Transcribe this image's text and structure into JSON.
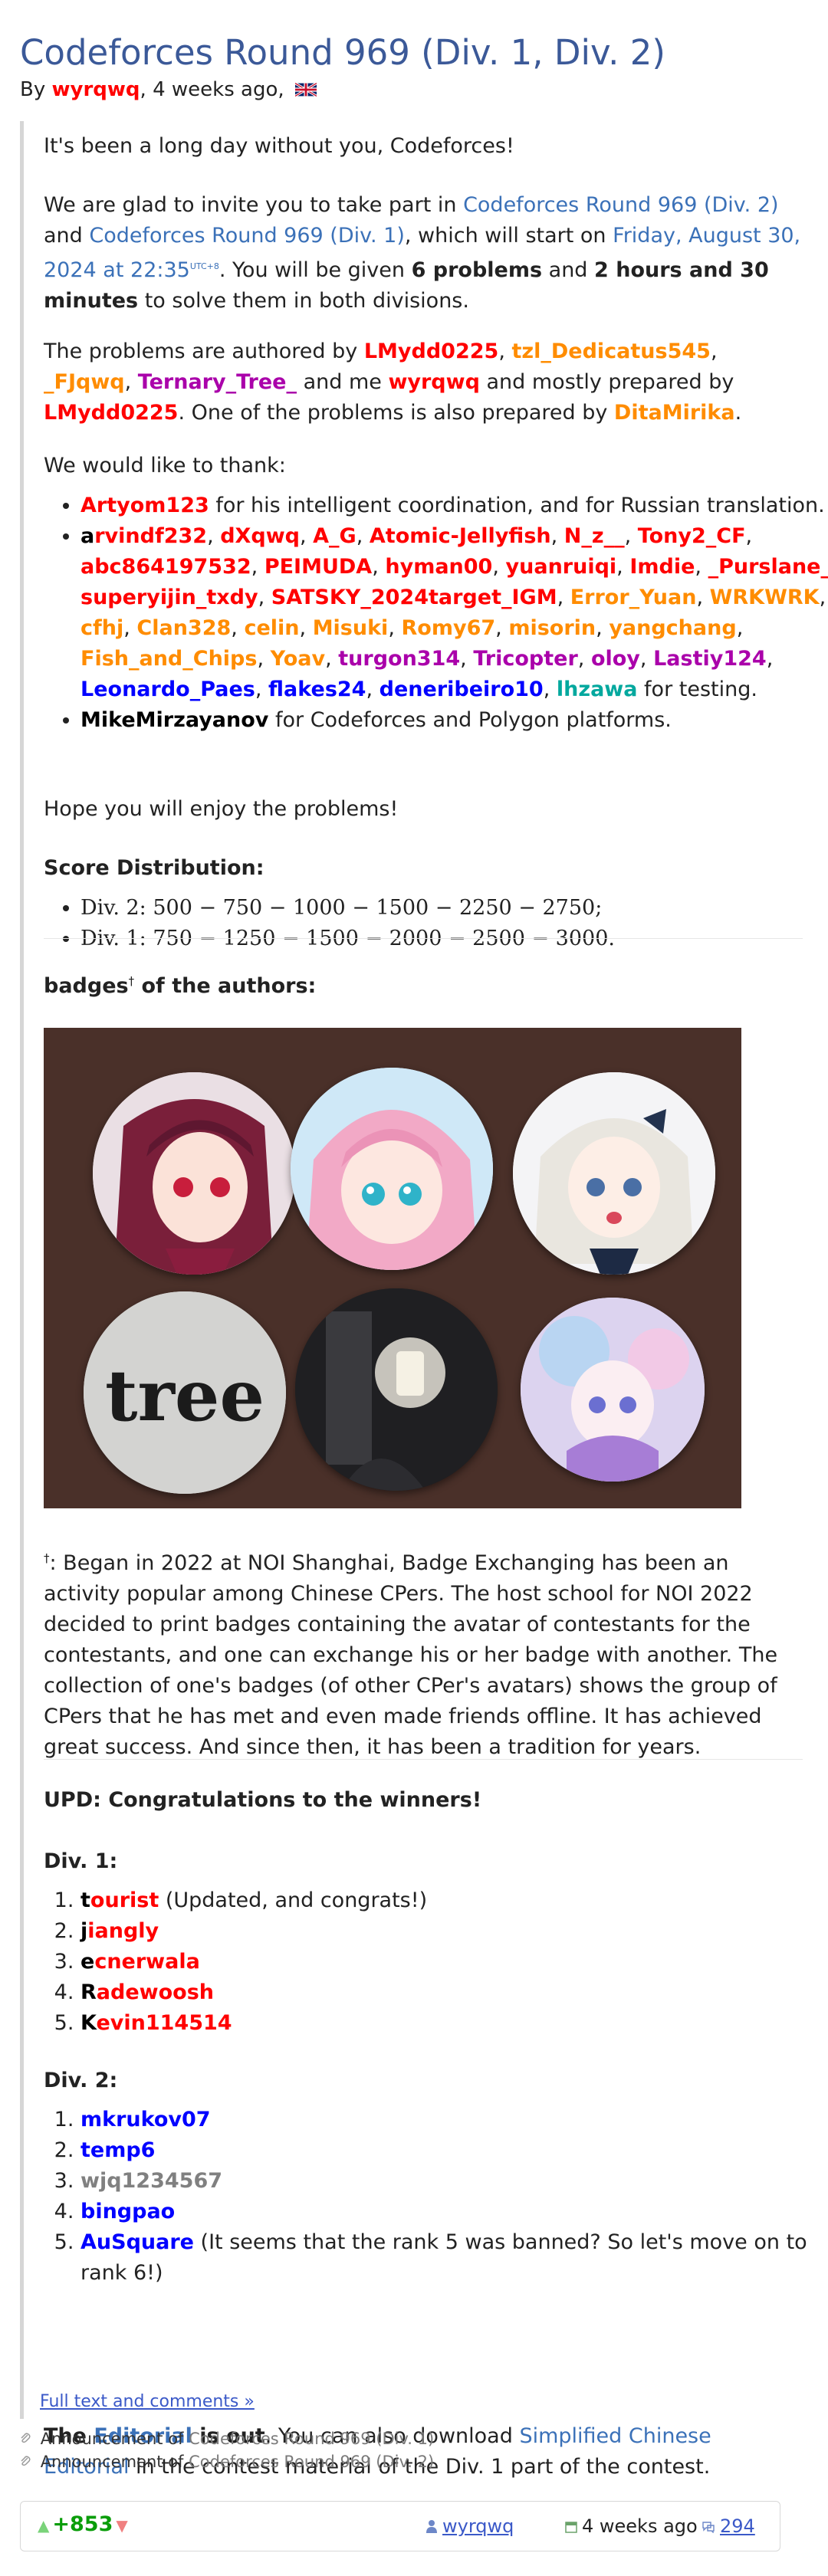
{
  "title": "Codeforces Round 969 (Div. 1, Div. 2)",
  "byline": {
    "by": "By",
    "author": "wyrqwq",
    "time": ", 4 weeks ago,",
    "flag": "uk-flag-icon"
  },
  "intro": "It's been a long day without you, Codeforces!",
  "invite": {
    "t1": "We are glad to invite you to take part in ",
    "div2_link": "Codeforces Round 969 (Div. 2)",
    "t2": " and ",
    "div1_link": "Codeforces Round 969 (Div. 1)",
    "t3": ", which will start on ",
    "date_link": "Friday, August 30, 2024 at 22:35",
    "date_sup": "UTC+8",
    "t4": ". You will be given ",
    "problems": "6 problems",
    "t5": " and ",
    "duration": "2 hours and 30 minutes",
    "t6": " to solve them in both divisions."
  },
  "authors_par": {
    "t1": "The problems are authored by ",
    "a1": "LMydd0225",
    "c1": ", ",
    "a2": "tzl_Dedicatus545",
    "c2": ", ",
    "a3": "_FJqwq",
    "c3": ", ",
    "a4": "Ternary_Tree_",
    "t2": " and me ",
    "a5": "wyrqwq",
    "t3": " and mostly prepared by ",
    "a6": "LMydd0225",
    "t4": ". One of the problems is also prepared by ",
    "a7": "DitaMirika",
    "t5": "."
  },
  "thanks_heading": "We would like to thank:",
  "thanks": {
    "first_user": "Artyom123",
    "first_text": " for his intelligent coordination, and for Russian translation.",
    "testers": [
      {
        "handle": "arvindf232",
        "color": "legendary"
      },
      {
        "handle": "dXqwq",
        "color": "red"
      },
      {
        "handle": "A_G",
        "color": "red"
      },
      {
        "handle": "Atomic-Jellyfish",
        "color": "red"
      },
      {
        "handle": "N_z__",
        "color": "red"
      },
      {
        "handle": "Tony2_CF",
        "color": "red"
      },
      {
        "handle": "abc864197532",
        "color": "red"
      },
      {
        "handle": "PEIMUDA",
        "color": "red"
      },
      {
        "handle": "hyman00",
        "color": "red"
      },
      {
        "handle": "yuanruiqi",
        "color": "red"
      },
      {
        "handle": "Imdie",
        "color": "red"
      },
      {
        "handle": "_Purslane_",
        "color": "red"
      },
      {
        "handle": "superyijin_txdy",
        "color": "red"
      },
      {
        "handle": "SATSKY_2024target_IGM",
        "color": "red"
      },
      {
        "handle": "Error_Yuan",
        "color": "orange"
      },
      {
        "handle": "WRKWRK",
        "color": "orange"
      },
      {
        "handle": "cfhj",
        "color": "orange"
      },
      {
        "handle": "Clan328",
        "color": "orange"
      },
      {
        "handle": "celin",
        "color": "orange"
      },
      {
        "handle": "Misuki",
        "color": "orange"
      },
      {
        "handle": "Romy67",
        "color": "orange"
      },
      {
        "handle": "misorin",
        "color": "orange"
      },
      {
        "handle": "yangchang",
        "color": "orange"
      },
      {
        "handle": "Fish_and_Chips",
        "color": "orange"
      },
      {
        "handle": "Yoav",
        "color": "orange"
      },
      {
        "handle": "turgon314",
        "color": "violet"
      },
      {
        "handle": "Tricopter",
        "color": "violet"
      },
      {
        "handle": "oloy",
        "color": "violet"
      },
      {
        "handle": "Lastiy124",
        "color": "violet"
      },
      {
        "handle": "Leonardo_Paes",
        "color": "blue"
      },
      {
        "handle": "flakes24",
        "color": "blue"
      },
      {
        "handle": "deneribeiro10",
        "color": "blue"
      },
      {
        "handle": "lhzawa",
        "color": "cyan"
      }
    ],
    "testers_suffix": " for testing.",
    "mike": "MikeMirzayanov",
    "mike_text": " for Codeforces and Polygon platforms."
  },
  "hope": "Hope you will enjoy the problems!",
  "score": {
    "heading": "Score Distribution:",
    "div2": "Div. 2: 500 − 750 − 1000 − 1500 − 2250 − 2750;",
    "div1": "Div. 1: 750 − 1250 − 1500 − 2000 − 2500 − 3000."
  },
  "badges_heading": {
    "text": "badges",
    "sup": "†",
    "rest": " of the authors:"
  },
  "badges_photo": [
    "red-haired-anime-girl-badge",
    "pink-haired-anime-girl-badge",
    "white-haired-anime-girl-badge",
    "tree-text-badge",
    "dark-lantern-scene-badge",
    "pastel-anime-character-badge"
  ],
  "badges_photo_text": "tree",
  "footnote": {
    "sup": "†",
    "text": ": Began in 2022 at NOI Shanghai, Badge Exchanging has been an activity popular among Chinese CPers. The host school for NOI 2022 decided to print badges containing the avatar of contestants for the contestants, and one can exchange his or her badge with another. The collection of one's badges (of other CPer's avatars) shows the group of CPers that he has met and even made friends offline. It has achieved great success. And since then, it has been a tradition for years."
  },
  "upd": "UPD: Congratulations to the winners!",
  "div1_winners": {
    "heading": "Div. 1:",
    "list": [
      {
        "first": "t",
        "rest": "ourist",
        "color": "legendary",
        "note": " (Updated, and congrats!)"
      },
      {
        "first": "j",
        "rest": "iangly",
        "color": "legendary",
        "note": ""
      },
      {
        "first": "e",
        "rest": "cnerwala",
        "color": "legendary",
        "note": ""
      },
      {
        "first": "R",
        "rest": "adewoosh",
        "color": "legendary",
        "note": ""
      },
      {
        "first": "K",
        "rest": "evin114514",
        "color": "legendary",
        "note": ""
      }
    ]
  },
  "div2_winners": {
    "heading": "Div. 2:",
    "list": [
      {
        "handle": "mkrukov07",
        "color": "blue",
        "note": ""
      },
      {
        "handle": "temp6",
        "color": "blue",
        "note": ""
      },
      {
        "handle": "wjq1234567",
        "color": "gray",
        "note": ""
      },
      {
        "handle": "bingpao",
        "color": "blue",
        "note": ""
      },
      {
        "handle": "AuSquare",
        "color": "blue",
        "note": " (It seems that the rank 5 was banned? So let's move on to rank 6!)"
      }
    ]
  },
  "editorial": {
    "t1": "The ",
    "link": "Editorial",
    "t2": " is out",
    "t3": ". You can also download ",
    "link2": "Simplified Chinese Editorial",
    "t4": " in the contest material of the Div. 1 part of the contest."
  },
  "full_text_link": "Full text and comments »",
  "announcements": [
    {
      "prefix": "Announcement of ",
      "link": "Codeforces Round 969 (Div. 1)"
    },
    {
      "prefix": "Announcement of ",
      "link": "Codeforces Round 969 (Div. 2)"
    }
  ],
  "footer": {
    "rating": "+853",
    "author": "wyrqwq",
    "time": "4 weeks ago",
    "comments": "294"
  },
  "colors": {
    "link": "#3b71b8",
    "red": "#ff0000",
    "orange": "#ff8c00",
    "violet": "#aa00aa",
    "blue": "#0000ff",
    "cyan": "#03a89e",
    "gray": "#808080",
    "rating": "#0a9d0a"
  }
}
